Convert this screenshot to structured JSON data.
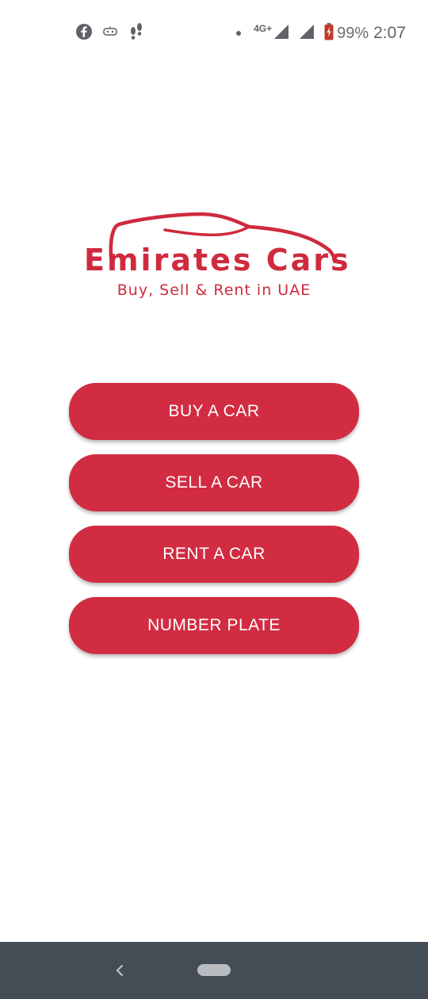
{
  "status_bar": {
    "left_icons": [
      "facebook-icon",
      "messenger-bot-icon",
      "footsteps-icon"
    ],
    "network_label": "4G+",
    "battery_percent": "99%",
    "time": "2:07",
    "icon_color": "#5f6368"
  },
  "logo": {
    "title": "Emirates Cars",
    "tagline": "Buy, Sell & Rent in UAE",
    "color": "#cf2a3e"
  },
  "menu": {
    "buttons": [
      {
        "label": "BUY A CAR"
      },
      {
        "label": "SELL A CAR"
      },
      {
        "label": "RENT A CAR"
      },
      {
        "label": "NUMBER PLATE"
      }
    ],
    "button_color": "#d12c42",
    "text_color": "#ffffff"
  },
  "nav_bar": {
    "icons": [
      "back-icon",
      "home-pill-icon"
    ],
    "background": "#444c55"
  }
}
